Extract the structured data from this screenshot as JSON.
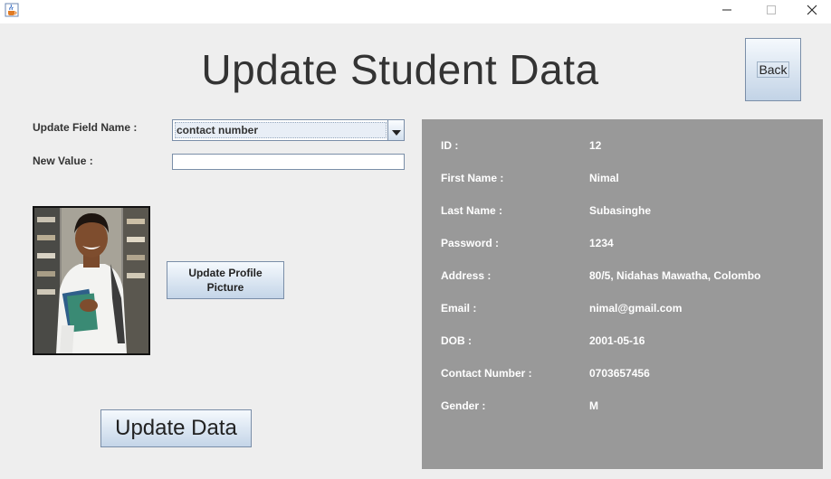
{
  "window": {
    "app_icon": "java-coffee-cup-icon",
    "controls": {
      "minimize_icon": "minimize-icon",
      "maximize_icon": "maximize-icon",
      "close_icon": "close-icon"
    }
  },
  "header": {
    "title": "Update Student Data",
    "back_label": "Back"
  },
  "form": {
    "field_name_label": "Update Field Name :",
    "field_name_selected": "contact number",
    "new_value_label": "New Value :",
    "new_value": "",
    "update_picture_label": "Update Profile Picture",
    "update_data_label": "Update Data"
  },
  "details": [
    {
      "label": "ID :",
      "value": "12"
    },
    {
      "label": "First Name :",
      "value": "Nimal"
    },
    {
      "label": "Last Name :",
      "value": "Subasinghe"
    },
    {
      "label": "Password :",
      "value": "1234"
    },
    {
      "label": "Address :",
      "value": "80/5, Nidahas Mawatha, Colombo"
    },
    {
      "label": "Email :",
      "value": "nimal@gmail.com"
    },
    {
      "label": "DOB :",
      "value": "2001-05-16"
    },
    {
      "label": "Contact Number :",
      "value": "0703657456"
    },
    {
      "label": "Gender :",
      "value": "M"
    }
  ],
  "colors": {
    "panel_bg": "#999999",
    "frame_bg": "#eeeeee",
    "button_gradient_bottom": "#c4d5e8"
  }
}
